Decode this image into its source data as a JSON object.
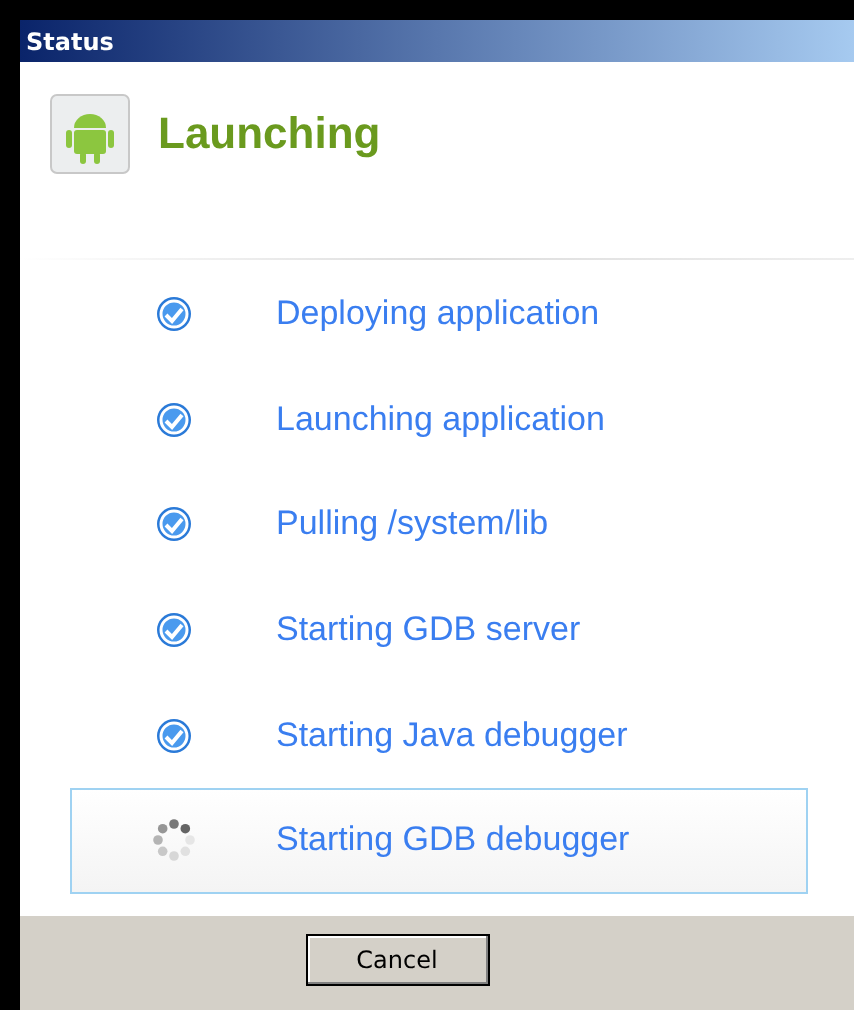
{
  "window": {
    "title": "Status"
  },
  "header": {
    "title": "Launching"
  },
  "steps": [
    {
      "label": "Deploying application",
      "kind": "done"
    },
    {
      "label": "Launching application",
      "kind": "done"
    },
    {
      "label": "Pulling /system/lib",
      "kind": "done"
    },
    {
      "label": "Starting GDB server",
      "kind": "done"
    },
    {
      "label": "Starting Java debugger",
      "kind": "done"
    },
    {
      "label": "Starting GDB debugger",
      "kind": "running"
    }
  ],
  "buttons": [
    "Cancel"
  ]
}
